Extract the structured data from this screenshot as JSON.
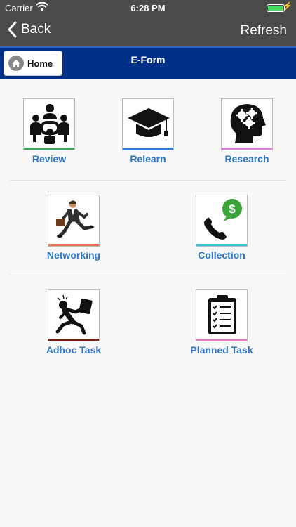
{
  "status_bar": {
    "carrier": "Carrier",
    "time": "6:28 PM"
  },
  "nav": {
    "back_label": "Back",
    "refresh_label": "Refresh"
  },
  "header": {
    "home_label": "Home",
    "title": "E-Form"
  },
  "tiles": [
    {
      "label": "Review",
      "icon": "meeting-icon",
      "accent": "#3aa45a"
    },
    {
      "label": "Relearn",
      "icon": "graduation-cap-icon",
      "accent": "#2f7fd1"
    },
    {
      "label": "Research",
      "icon": "head-gears-icon",
      "accent": "#d77fd9"
    },
    {
      "label": "Networking",
      "icon": "businessman-running-icon",
      "accent": "#e6704f"
    },
    {
      "label": "Collection",
      "icon": "phone-dollar-icon",
      "accent": "#3cc4d6"
    },
    {
      "label": "Adhoc Task",
      "icon": "person-rushing-icon",
      "accent": "#7a1c14"
    },
    {
      "label": "Planned Task",
      "icon": "clipboard-checklist-icon",
      "accent": "#e07db7"
    }
  ],
  "colors": {
    "status_nav_bg": "#4a4a4a",
    "header_bg": "#003087",
    "label_blue": "#2f76c6"
  }
}
